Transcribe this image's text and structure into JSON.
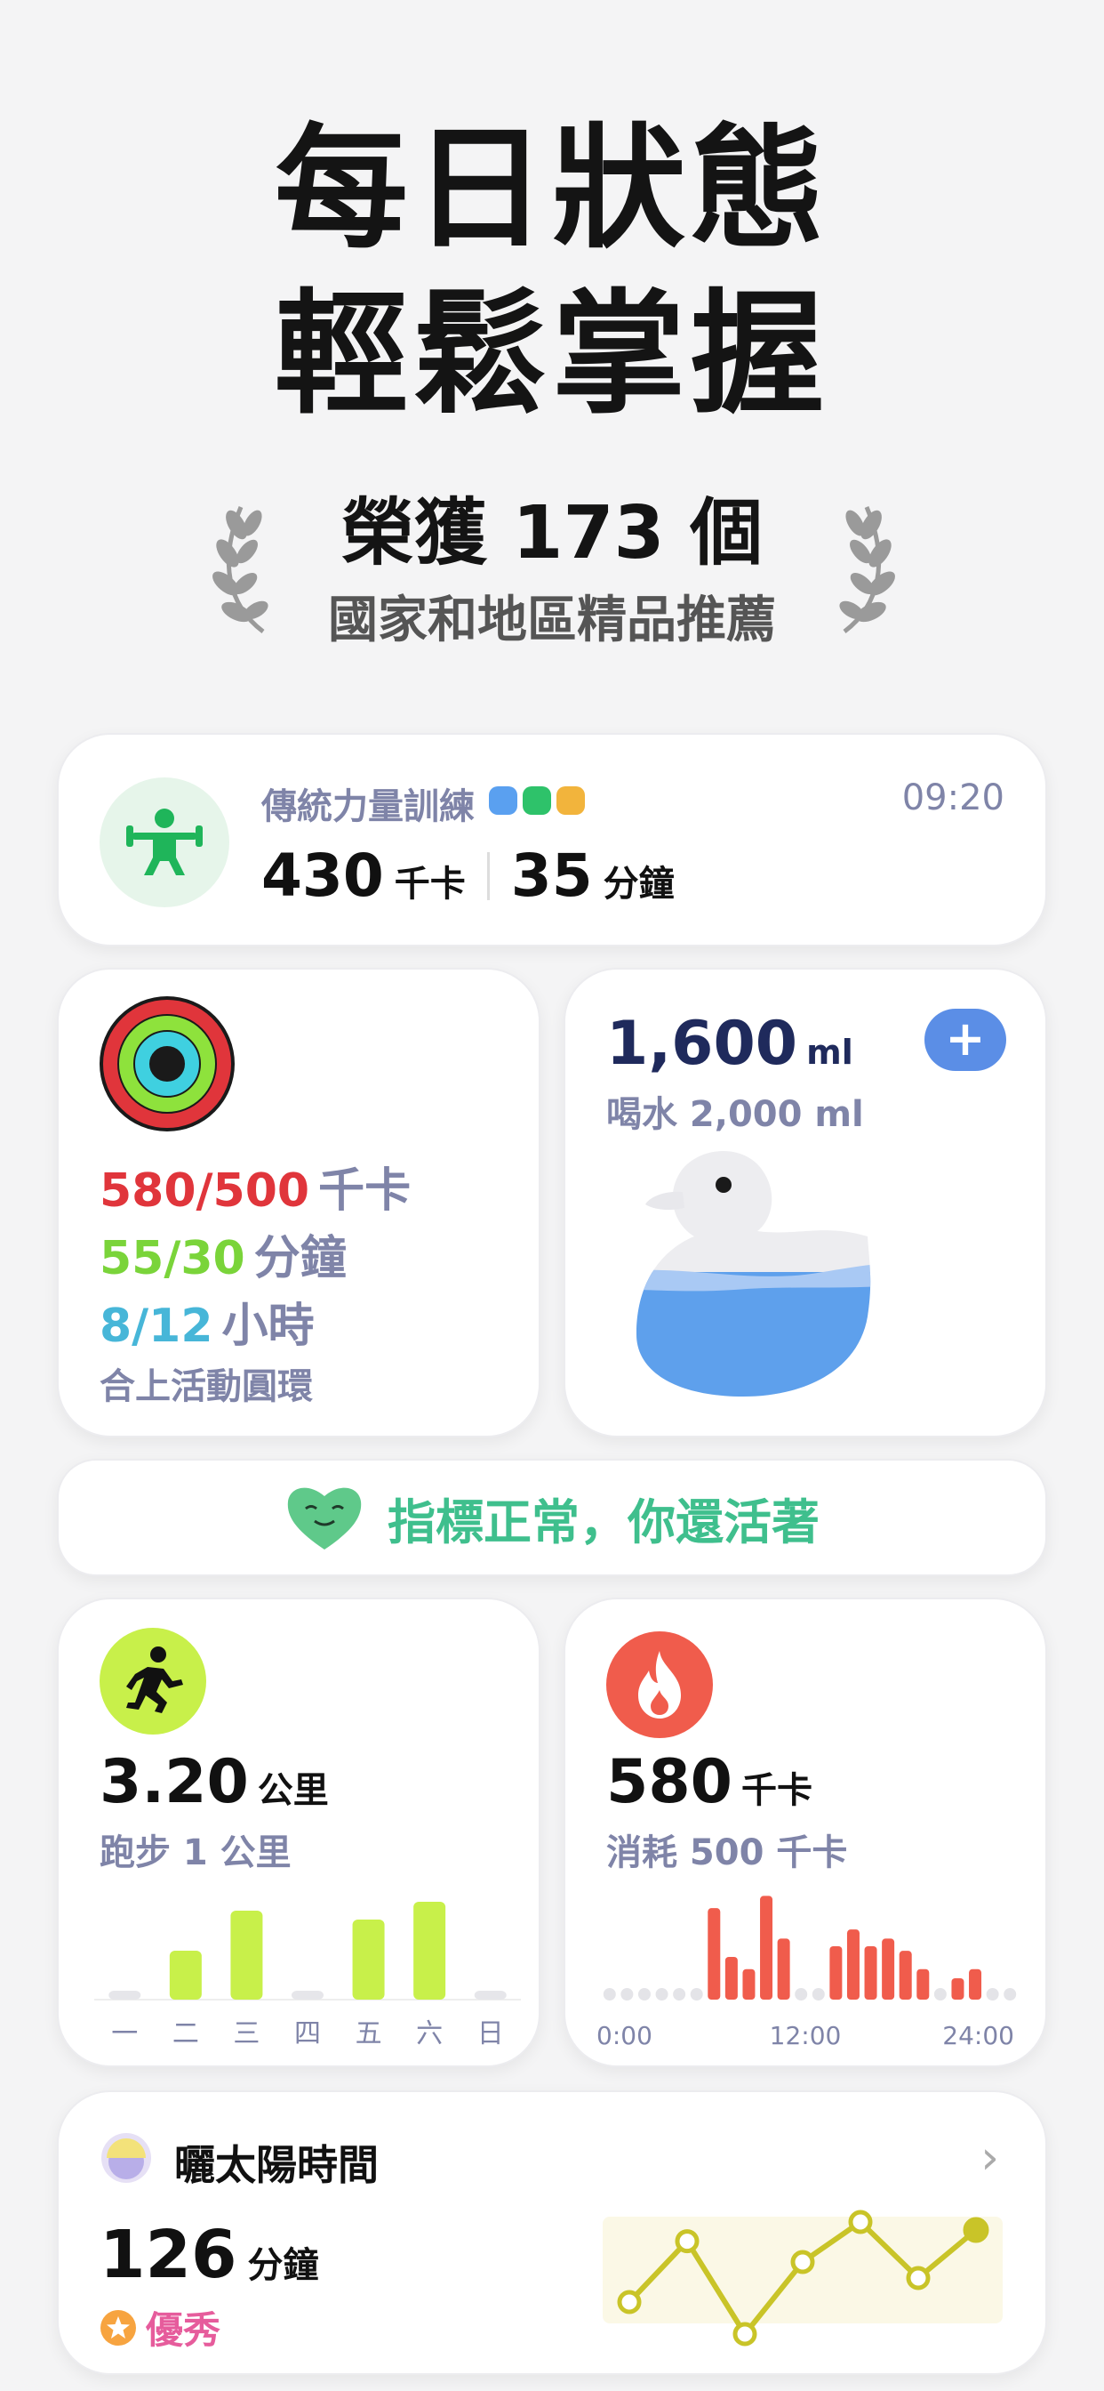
{
  "hero": {
    "line1": "每日狀態",
    "line2": "輕鬆掌握"
  },
  "award": {
    "main": "榮獲 173 個",
    "sub": "國家和地區精品推薦"
  },
  "workout": {
    "title": "傳統力量訓練",
    "time": "09:20",
    "calories": "430",
    "calories_unit": "千卡",
    "minutes": "35",
    "minutes_unit": "分鐘",
    "dot_colors": [
      "#5aa0f0",
      "#2ec26a",
      "#f2b43c"
    ]
  },
  "activity": {
    "move": {
      "value": "580/500",
      "unit": "千卡",
      "color": "#e0353b"
    },
    "exercise": {
      "value": "55/30",
      "unit": "分鐘",
      "color": "#7ad43a"
    },
    "stand": {
      "value": "8/12",
      "unit": "小時",
      "color": "#47b6d8"
    },
    "footer": "合上活動圓環"
  },
  "water": {
    "value": "1,600",
    "unit": "ml",
    "goal": "喝水 2,000 ml",
    "add_label": "+",
    "progress": 0.8
  },
  "status": {
    "text": "指標正常，你還活著",
    "heart_color": "#5fc98a"
  },
  "running": {
    "value": "3.20",
    "unit": "公里",
    "goal": "跑步 1 公里",
    "days": [
      "一",
      "二",
      "三",
      "四",
      "五",
      "六",
      "日"
    ],
    "bar_color": "#c8f04a"
  },
  "calorie": {
    "value": "580",
    "unit": "千卡",
    "goal": "消耗 500 千卡",
    "x_labels": [
      "0:00",
      "12:00",
      "24:00"
    ],
    "bar_color": "#f05c4c"
  },
  "sun": {
    "title": "曬太陽時間",
    "value": "126",
    "unit": "分鐘",
    "badge": "優秀",
    "line_color": "#c9c428"
  },
  "chart_data": [
    {
      "type": "bar",
      "categories": [
        "一",
        "二",
        "三",
        "四",
        "五",
        "六",
        "日"
      ],
      "values": [
        0,
        0.55,
        1.0,
        0,
        0.9,
        1.1,
        0
      ]
    },
    {
      "type": "bar",
      "categories": [
        "0:00",
        "1",
        "2",
        "3",
        "4",
        "5",
        "6",
        "7",
        "8",
        "9",
        "10",
        "11",
        "12:00",
        "13",
        "14",
        "15",
        "16",
        "17",
        "18",
        "19",
        "20",
        "21",
        "22",
        "24:00"
      ],
      "values": [
        0,
        0,
        0,
        0,
        0,
        0,
        60,
        28,
        20,
        68,
        40,
        0,
        0,
        35,
        46,
        35,
        40,
        32,
        20,
        0,
        14,
        20,
        0,
        0
      ]
    },
    {
      "type": "line",
      "x": [
        1,
        2,
        3,
        4,
        5,
        6,
        7
      ],
      "y": [
        30,
        68,
        10,
        55,
        80,
        45,
        75
      ]
    }
  ]
}
